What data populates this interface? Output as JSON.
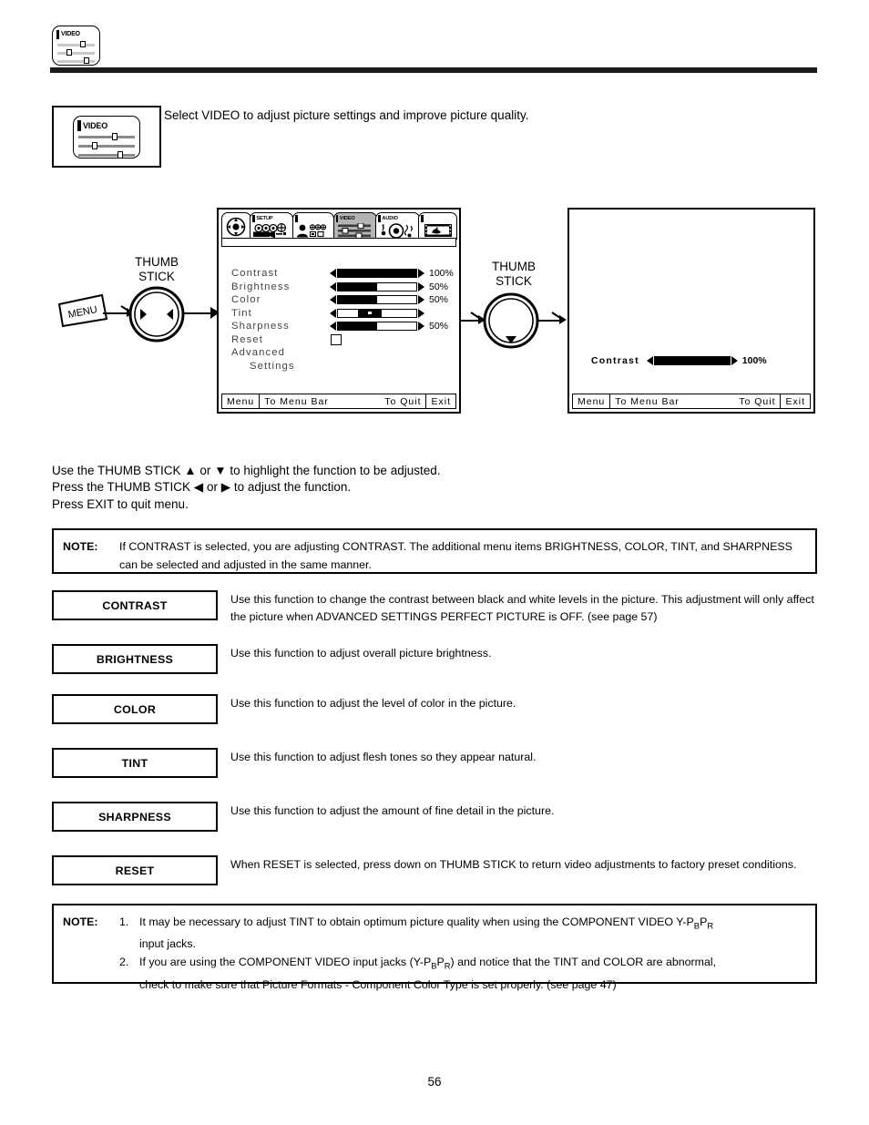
{
  "header": {
    "icon_label": "VIDEO",
    "icon_name": "video-settings-icon"
  },
  "intro": {
    "icon_label": "VIDEO",
    "text": "Select VIDEO to adjust picture settings and improve picture quality."
  },
  "diagram": {
    "menu_button_label": "MENU",
    "thumbstick_label_line1": "THUMB",
    "thumbstick_label_line2": "STICK"
  },
  "osd_left": {
    "tabs": [
      {
        "label": "",
        "icon": "navigation-pad-icon",
        "selected": false
      },
      {
        "label": "SETUP",
        "icon": "setup-camera-icon",
        "selected": false
      },
      {
        "label": "",
        "icon": "person-lock-icon",
        "selected": false
      },
      {
        "label": "VIDEO",
        "icon": "video-sliders-icon",
        "selected": true
      },
      {
        "label": "AUDIO",
        "icon": "audio-speaker-icon",
        "selected": false
      },
      {
        "label": "",
        "icon": "film-strip-icon",
        "selected": false
      }
    ],
    "items": [
      {
        "label": "Contrast",
        "control": "slider",
        "fill_pct": 100,
        "value": "100%"
      },
      {
        "label": "Brightness",
        "control": "slider",
        "fill_pct": 50,
        "value": "50%"
      },
      {
        "label": "Color",
        "control": "slider",
        "fill_pct": 50,
        "value": "50%"
      },
      {
        "label": "Tint",
        "control": "centered",
        "fill_pct": 50,
        "value": ""
      },
      {
        "label": "Sharpness",
        "control": "slider",
        "fill_pct": 50,
        "value": "50%"
      },
      {
        "label": "Reset",
        "control": "checkbox",
        "fill_pct": 0,
        "value": ""
      },
      {
        "label": "Advanced",
        "control": "none",
        "fill_pct": 0,
        "value": ""
      },
      {
        "label": "Settings",
        "control": "none",
        "fill_pct": 0,
        "value": "",
        "indent": true
      }
    ],
    "footer": {
      "menu": "Menu",
      "to_menu_bar": "To Menu Bar",
      "to_quit": "To Quit",
      "exit": "Exit"
    }
  },
  "osd_right": {
    "readout_label": "Contrast",
    "readout_value": "100%",
    "readout_fill_pct": 100,
    "footer": {
      "menu": "Menu",
      "to_menu_bar": "To Menu Bar",
      "to_quit": "To Quit",
      "exit": "Exit"
    }
  },
  "instructions": {
    "line1_a": "Use the THUMB STICK ",
    "line1_up": "▲",
    "line1_b": " or ",
    "line1_down": "▼",
    "line1_c": " to highlight the function to be adjusted.",
    "line2_a": "Press the THUMB STICK ",
    "line2_left": "◀",
    "line2_b": " or ",
    "line2_right": "▶",
    "line2_c": " to adjust the function.",
    "line3": "Press EXIT to quit menu."
  },
  "note_top": {
    "label": "NOTE:",
    "text": "If CONTRAST is selected, you are adjusting CONTRAST.  The additional menu items BRIGHTNESS, COLOR, TINT, and SHARPNESS can be selected and adjusted in the same manner."
  },
  "functions": [
    {
      "name": "CONTRAST",
      "desc": "Use this function to change the contrast between black and white levels in the picture.  This adjustment will only affect the picture when ADVANCED SETTINGS PERFECT PICTURE is OFF. (see page 57)"
    },
    {
      "name": "BRIGHTNESS",
      "desc": "Use this function to adjust overall picture brightness."
    },
    {
      "name": "COLOR",
      "desc": "Use this function to adjust the level of color in the picture."
    },
    {
      "name": "TINT",
      "desc": "Use this function to adjust flesh tones so they appear natural."
    },
    {
      "name": "SHARPNESS",
      "desc": "Use this function to adjust the amount of fine detail in the picture."
    },
    {
      "name": "RESET",
      "desc": "When RESET is selected, press down on THUMB STICK to return video adjustments to factory preset conditions."
    }
  ],
  "note_bottom": {
    "label": "NOTE:",
    "item1_num": "1.",
    "item1_a": "It may be necessary to adjust TINT to obtain optimum picture quality when using the COMPONENT VIDEO Y-P",
    "item1_sub1": "B",
    "item1_b": "P",
    "item1_sub2": "R",
    "item1_c": "input jacks.",
    "item2_num": "2.",
    "item2_a": "If you are using the COMPONENT VIDEO input jacks (Y-P",
    "item2_sub1": "B",
    "item2_b": "P",
    "item2_sub2": "R",
    "item2_c": ") and notice that the TINT and COLOR are abnormal,",
    "item2_d": "check to make sure that Picture Formats - Component Color Type is set properly. (see page 47)"
  },
  "page_number": "56"
}
